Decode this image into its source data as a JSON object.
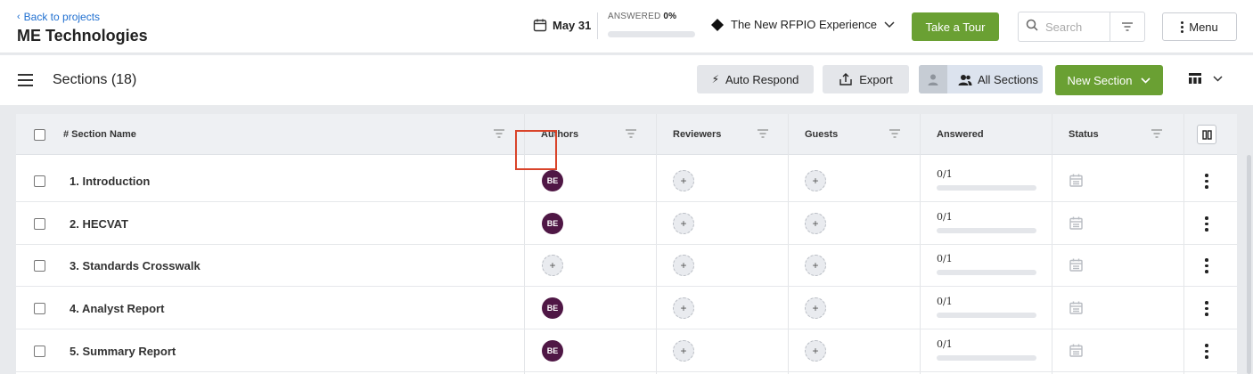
{
  "header": {
    "back_label": "Back to projects",
    "project_title": "ME Technologies",
    "date": "May 31",
    "answered_label": "ANSWERED",
    "answered_pct": "0%",
    "answered_fraction": 0,
    "experience_label": "The New RFPIO Experience",
    "tour_button": "Take a Tour",
    "search_placeholder": "Search",
    "menu_label": "Menu"
  },
  "toolbar": {
    "sections_title": "Sections (18)",
    "auto_respond": "Auto Respond",
    "export": "Export",
    "all_sections": "All Sections",
    "new_section": "New Section"
  },
  "table": {
    "columns": {
      "section_name": "# Section Name",
      "authors": "Authors",
      "reviewers": "Reviewers",
      "guests": "Guests",
      "answered": "Answered",
      "status": "Status"
    },
    "rows": [
      {
        "name": "1. Introduction",
        "author": "BE",
        "answered": "0/1"
      },
      {
        "name": "2. HECVAT",
        "author": "BE",
        "answered": "0/1"
      },
      {
        "name": "3. Standards Crosswalk",
        "author": "",
        "answered": "0/1"
      },
      {
        "name": "4. Analyst Report",
        "author": "BE",
        "answered": "0/1"
      },
      {
        "name": "5. Summary Report",
        "author": "BE",
        "answered": "0/1"
      }
    ]
  },
  "colors": {
    "primary_green": "#6aa033",
    "author_badge": "#4f1745",
    "link_blue": "#1f6fd0",
    "highlight_red": "#d9442a"
  }
}
